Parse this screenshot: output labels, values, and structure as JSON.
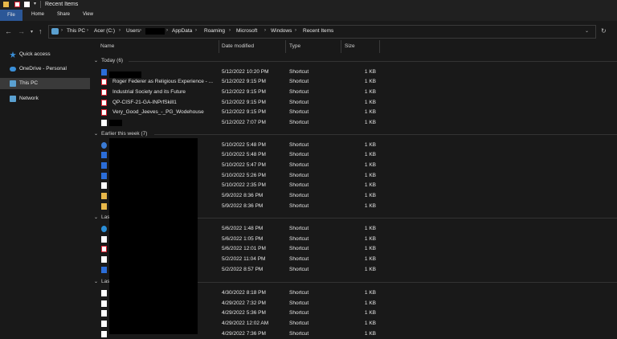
{
  "window": {
    "title": "Recent Items"
  },
  "ribbon": {
    "tabs": [
      "File",
      "Home",
      "Share",
      "View"
    ]
  },
  "address": {
    "crumbs": [
      "This PC",
      "Acer (C:)",
      "Users",
      "",
      "AppData",
      "Roaming",
      "Microsoft",
      "Windows",
      "Recent Items"
    ]
  },
  "sidebar": {
    "items": [
      {
        "label": "Quick access",
        "icon": "star-icon"
      },
      {
        "label": "OneDrive - Personal",
        "icon": "cloud-icon"
      },
      {
        "label": "This PC",
        "icon": "computer-icon"
      },
      {
        "label": "Network",
        "icon": "network-icon"
      }
    ]
  },
  "columns": {
    "name": "Name",
    "date": "Date modified",
    "type": "Type",
    "size": "Size"
  },
  "groups": [
    {
      "title": "Today (6)",
      "rows": [
        {
          "name": "",
          "date": "5/12/2022 10:20 PM",
          "type": "Shortcut",
          "size": "1 KB",
          "icon": "word"
        },
        {
          "name": "Roger Federer as Religious Experience - ...",
          "date": "5/12/2022 9:15 PM",
          "type": "Shortcut",
          "size": "1 KB",
          "icon": "pdf"
        },
        {
          "name": "Industrial Society and its Future",
          "date": "5/12/2022 9:15 PM",
          "type": "Shortcut",
          "size": "1 KB",
          "icon": "pdf"
        },
        {
          "name": "QP-CISF-21-GA-INPrfSkill1",
          "date": "5/12/2022 9:15 PM",
          "type": "Shortcut",
          "size": "1 KB",
          "icon": "pdf"
        },
        {
          "name": "Very_Good_Jeeves_-_PG_Wodehouse",
          "date": "5/12/2022 9:15 PM",
          "type": "Shortcut",
          "size": "1 KB",
          "icon": "pdf"
        },
        {
          "name": "",
          "date": "5/12/2022 7:07 PM",
          "type": "Shortcut",
          "size": "1 KB",
          "icon": "doc"
        }
      ]
    },
    {
      "title": "Earlier this week (7)",
      "rows": [
        {
          "name": "",
          "date": "5/10/2022 5:48 PM",
          "type": "Shortcut",
          "size": "1 KB",
          "icon": "blue"
        },
        {
          "name": "",
          "date": "5/10/2022 5:48 PM",
          "type": "Shortcut",
          "size": "1 KB",
          "icon": "word"
        },
        {
          "name": "",
          "date": "5/10/2022 5:47 PM",
          "type": "Shortcut",
          "size": "1 KB",
          "icon": "word"
        },
        {
          "name": "",
          "date": "5/10/2022 5:26 PM",
          "type": "Shortcut",
          "size": "1 KB",
          "icon": "word"
        },
        {
          "name": "",
          "date": "5/10/2022 2:35 PM",
          "type": "Shortcut",
          "size": "1 KB",
          "icon": "doc"
        },
        {
          "name": "",
          "date": "5/9/2022 8:36 PM",
          "type": "Shortcut",
          "size": "1 KB",
          "icon": "folder"
        },
        {
          "name": "",
          "date": "5/9/2022 8:36 PM",
          "type": "Shortcut",
          "size": "1 KB",
          "icon": "folder"
        }
      ]
    },
    {
      "title": "Las",
      "rows": [
        {
          "name": "",
          "date": "5/6/2022 1:48 PM",
          "type": "Shortcut",
          "size": "1 KB",
          "icon": "edge"
        },
        {
          "name": "",
          "date": "5/6/2022 1:05 PM",
          "type": "Shortcut",
          "size": "1 KB",
          "icon": "doc"
        },
        {
          "name": "",
          "date": "5/6/2022 12:01 PM",
          "type": "Shortcut",
          "size": "1 KB",
          "icon": "pdf"
        },
        {
          "name": "ideos ...",
          "date": "5/2/2022 11:04 PM",
          "type": "Shortcut",
          "size": "1 KB",
          "icon": "doc"
        },
        {
          "name": "",
          "date": "5/2/2022 8:57 PM",
          "type": "Shortcut",
          "size": "1 KB",
          "icon": "word"
        }
      ]
    },
    {
      "title": "Las",
      "rows": [
        {
          "name": "ntent ...",
          "date": "4/30/2022 8:18 PM",
          "type": "Shortcut",
          "size": "1 KB",
          "icon": "doc"
        },
        {
          "name": "",
          "date": "4/29/2022 7:32 PM",
          "type": "Shortcut",
          "size": "1 KB",
          "icon": "doc"
        },
        {
          "name": "our Ins...",
          "date": "4/29/2022 5:36 PM",
          "type": "Shortcut",
          "size": "1 KB",
          "icon": "doc"
        },
        {
          "name": "els fr...",
          "date": "4/29/2022 12:02 AM",
          "type": "Shortcut",
          "size": "1 KB",
          "icon": "doc"
        },
        {
          "name": "",
          "date": "4/29/2022 7:36 PM",
          "type": "Shortcut",
          "size": "1 KB",
          "icon": "doc"
        }
      ]
    }
  ]
}
